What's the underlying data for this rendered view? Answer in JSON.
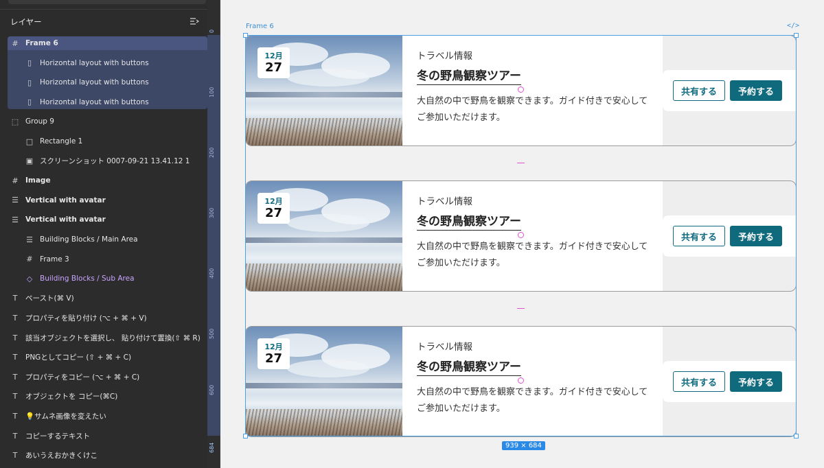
{
  "layers_panel": {
    "title": "レイヤー",
    "items": [
      {
        "label": "Frame 6",
        "icon": "frame-icon"
      },
      {
        "label": "Horizontal layout with buttons",
        "icon": "horizontal-layout-icon"
      },
      {
        "label": "Horizontal layout with buttons",
        "icon": "horizontal-layout-icon"
      },
      {
        "label": "Horizontal layout with buttons",
        "icon": "horizontal-layout-icon"
      },
      {
        "label": "Group 9",
        "icon": "group-icon"
      },
      {
        "label": "Rectangle 1",
        "icon": "rectangle-icon"
      },
      {
        "label": "スクリーンショット 0007-09-21 13.41.12 1",
        "icon": "image-icon"
      },
      {
        "label": "Image",
        "icon": "frame-icon"
      },
      {
        "label": "Vertical with avatar",
        "icon": "vertical-layout-icon"
      },
      {
        "label": "Vertical with avatar",
        "icon": "vertical-layout-icon"
      },
      {
        "label": "Building Blocks / Main Area",
        "icon": "vertical-layout-icon"
      },
      {
        "label": "Frame 3",
        "icon": "frame-icon"
      },
      {
        "label": "Building Blocks / Sub Area",
        "icon": "component-icon"
      },
      {
        "label": "ペースト(⌘ V)",
        "icon": "text-icon"
      },
      {
        "label": "プロパティを貼り付け (⌥ + ⌘ + V)",
        "icon": "text-icon"
      },
      {
        "label": "該当オブジェクトを選択し、 貼り付けて置換(⇧ ⌘ R)",
        "icon": "text-icon"
      },
      {
        "label": "PNGとしてコピー (⇧ + ⌘ + C)",
        "icon": "text-icon"
      },
      {
        "label": "プロパティをコピー (⌥ + ⌘ + C)",
        "icon": "text-icon"
      },
      {
        "label": "オブジェクトを コピー(⌘C)",
        "icon": "text-icon"
      },
      {
        "label": "💡サムネ画像を変えたい",
        "icon": "text-icon"
      },
      {
        "label": "コピーするテキスト",
        "icon": "text-icon"
      },
      {
        "label": "あいうえおかきくけこ",
        "icon": "text-icon"
      }
    ]
  },
  "ruler": {
    "ticks": [
      "0",
      "100",
      "200",
      "300",
      "400",
      "500",
      "600",
      "684"
    ]
  },
  "canvas": {
    "frame_label": "Frame 6",
    "code_icon_label": "</>",
    "size_badge": "939 × 684"
  },
  "cards": [
    {
      "month": "12月",
      "day": "27",
      "category": "トラベル情報",
      "title": "冬の野鳥観察ツアー",
      "description": "大自然の中で野鳥を観察できます。ガイド付きで安心してご参加いただけます。",
      "share_label": "共有する",
      "book_label": "予約する"
    },
    {
      "month": "12月",
      "day": "27",
      "category": "トラベル情報",
      "title": "冬の野鳥観察ツアー",
      "description": "大自然の中で野鳥を観察できます。ガイド付きで安心してご参加いただけます。",
      "share_label": "共有する",
      "book_label": "予約する"
    },
    {
      "month": "12月",
      "day": "27",
      "category": "トラベル情報",
      "title": "冬の野鳥観察ツアー",
      "description": "大自然の中で野鳥を観察できます。ガイド付きで安心してご参加いただけます。",
      "share_label": "共有する",
      "book_label": "予約する"
    }
  ],
  "colors": {
    "accent": "#0f6a7e",
    "selection": "#4a9fe5",
    "spacing_marker": "#e34fd1"
  }
}
